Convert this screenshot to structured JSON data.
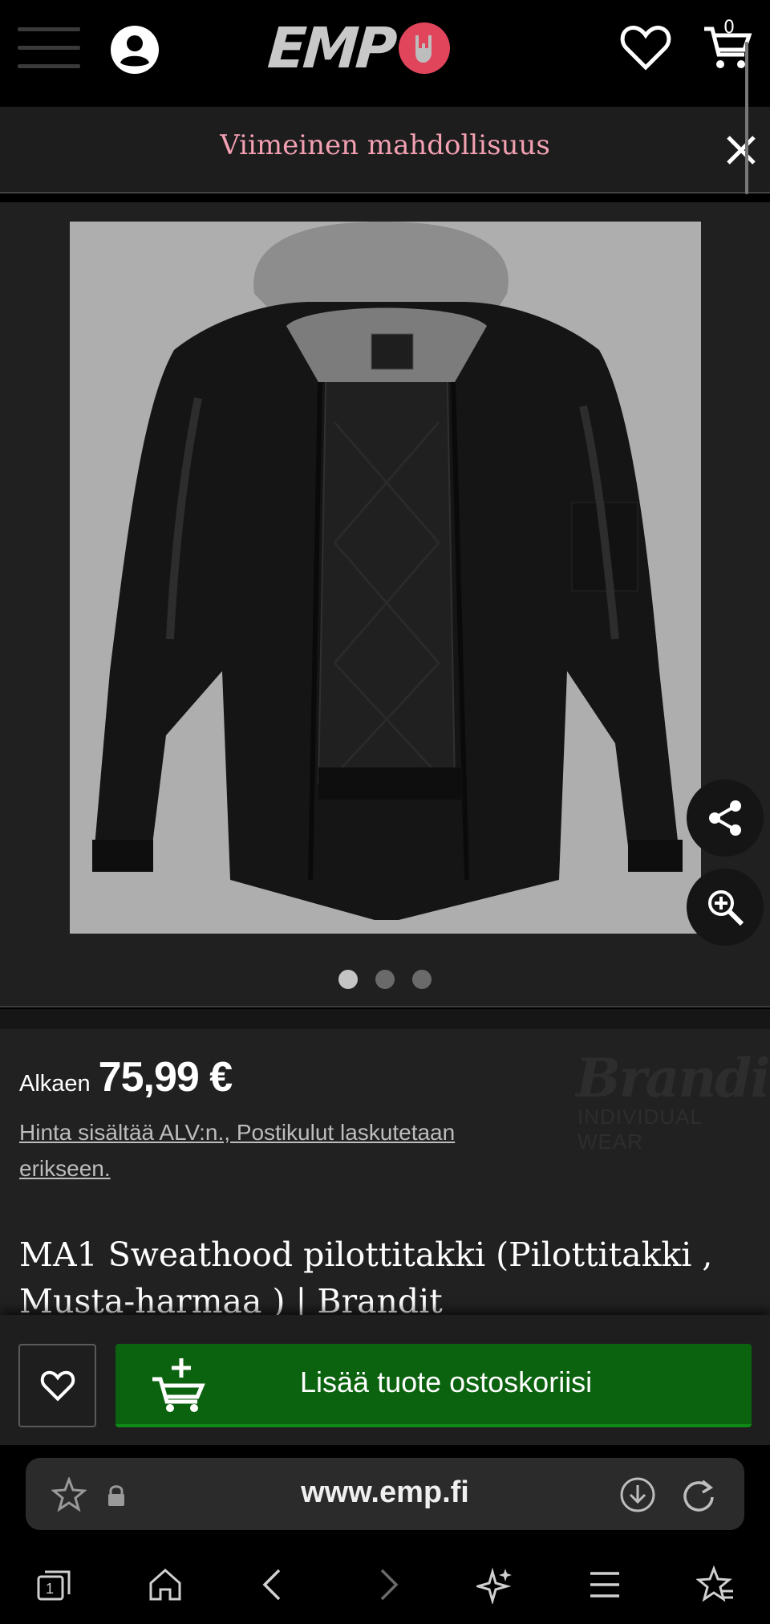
{
  "header": {
    "menu_icon": "hamburger-icon",
    "account_icon": "account-icon",
    "logo_text": "EMP",
    "wishlist_icon": "heart-icon",
    "cart_icon": "cart-icon",
    "cart_count": "0"
  },
  "banner": {
    "text": "Viimeinen mahdollisuus",
    "close_icon": "close-icon"
  },
  "gallery": {
    "image_alt": "MA1 Sweathood pilottitakki",
    "slide_count": 3,
    "active_slide": 1,
    "share_icon": "share-icon",
    "zoom_icon": "zoom-in-icon"
  },
  "product": {
    "price_prefix": "Alkaen",
    "price": "75,99 €",
    "price_note": "Hinta sisältää ALV:n., Postikulut laskutetaan erikseen.",
    "brand_name": "Brandit",
    "brand_subtitle": "INDIVIDUAL WEAR",
    "title": "MA1 Sweathood pilottitakki (Pilottitakki , Musta-harmaa ) | Brandit"
  },
  "sticky": {
    "wishlist_icon": "heart-icon",
    "add_to_cart_label": "Lisää tuote ostoskoriisi",
    "add_to_cart_icon": "cart-add-icon"
  },
  "browser": {
    "url": "www.emp.fi",
    "tab_count": "1",
    "icons": [
      "bookmark-star-icon",
      "lock-icon",
      "download-icon",
      "reload-icon",
      "tabs-icon",
      "home-icon",
      "back-icon",
      "forward-icon",
      "ai-sparkle-icon",
      "menu-icon",
      "favorites-icon"
    ]
  },
  "colors": {
    "accent_pink": "#f3a0b2",
    "cta_green": "#0b620f",
    "logo_badge": "#e0455c"
  }
}
